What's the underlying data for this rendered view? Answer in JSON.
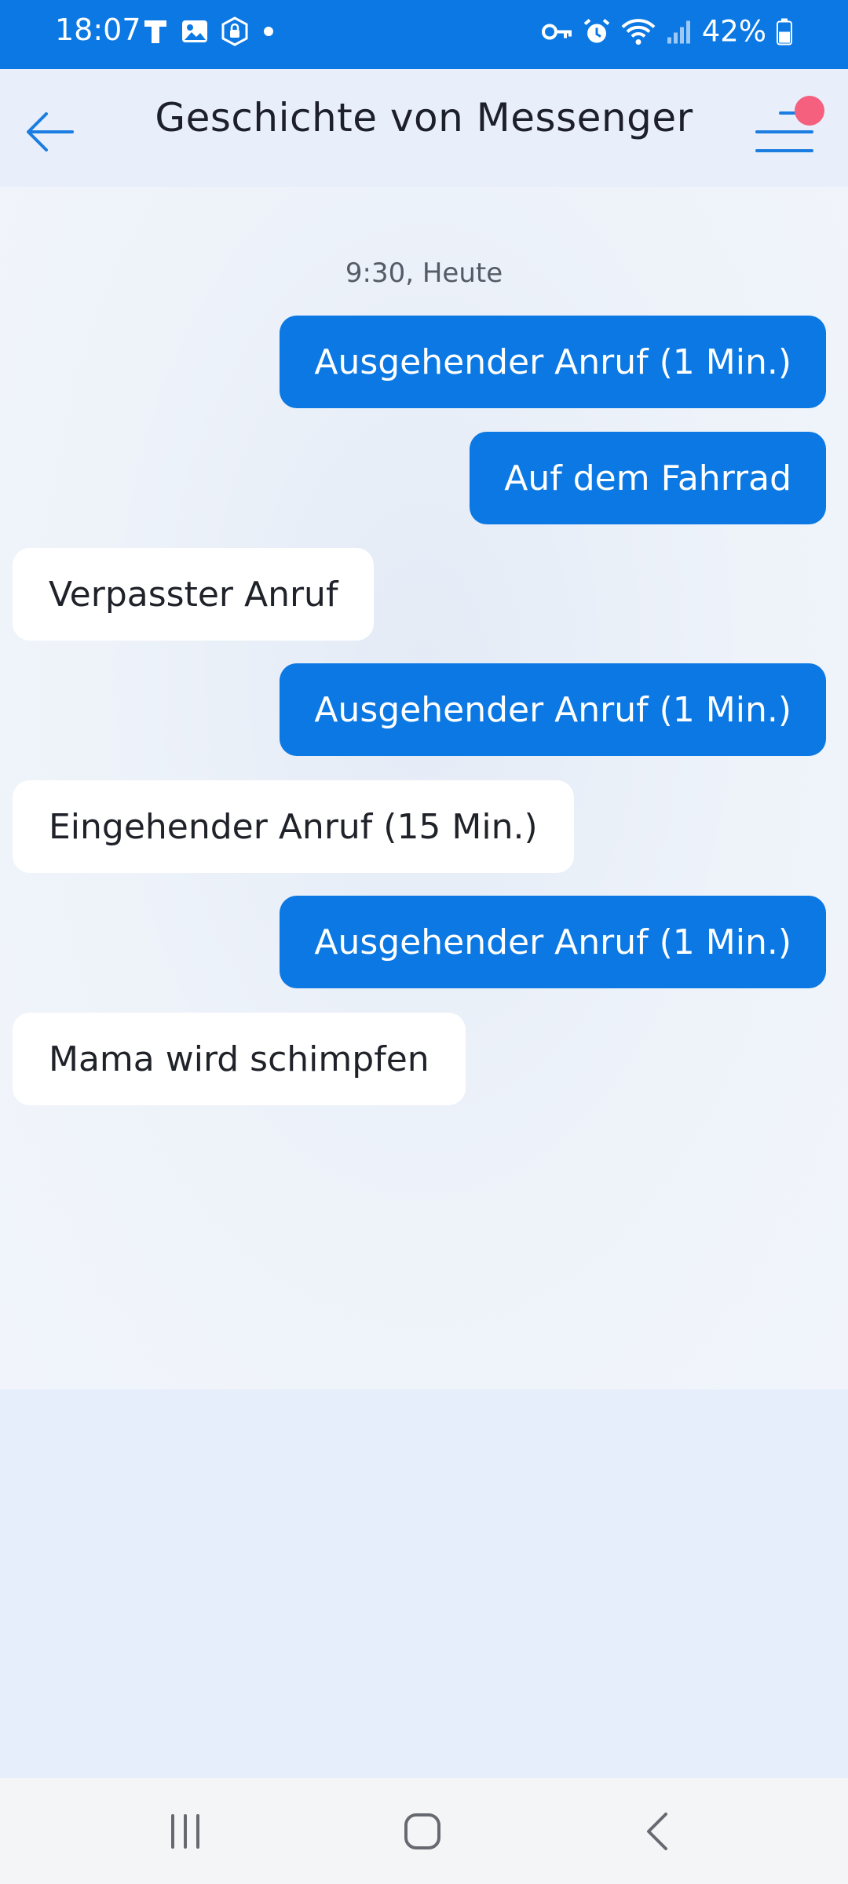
{
  "status_bar": {
    "time": "18:07",
    "battery_percent": "42%",
    "left_icons": [
      "t-icon",
      "image-icon",
      "secure-folder-icon",
      "dot-icon"
    ],
    "right_icons": [
      "key-icon",
      "alarm-icon",
      "wifi-icon",
      "signal-icon",
      "battery-icon"
    ]
  },
  "header": {
    "title": "Geschichte von Messenger",
    "back_icon": "arrow-left-icon",
    "menu_icon": "menu-icon",
    "notification_color": "#f4607e"
  },
  "chat": {
    "timestamp": "9:30, Heute",
    "messages": [
      {
        "direction": "outgoing",
        "text": "Ausgehender Anruf (1 Min.)"
      },
      {
        "direction": "outgoing",
        "text": "Auf dem Fahrrad"
      },
      {
        "direction": "incoming",
        "text": "Verpasster Anruf"
      },
      {
        "direction": "outgoing",
        "text": "Ausgehender Anruf (1 Min.)"
      },
      {
        "direction": "incoming",
        "text": "Eingehender Anruf (15 Min.)"
      },
      {
        "direction": "outgoing",
        "text": "Ausgehender Anruf (1 Min.)"
      },
      {
        "direction": "incoming",
        "text": "Mama wird schimpfen"
      }
    ]
  },
  "colors": {
    "accent": "#0b78e3",
    "incoming_bubble": "#ffffff",
    "background": "#e6eefc"
  },
  "nav_bar": {
    "icons": [
      "recent-apps-icon",
      "home-icon",
      "back-icon"
    ]
  }
}
